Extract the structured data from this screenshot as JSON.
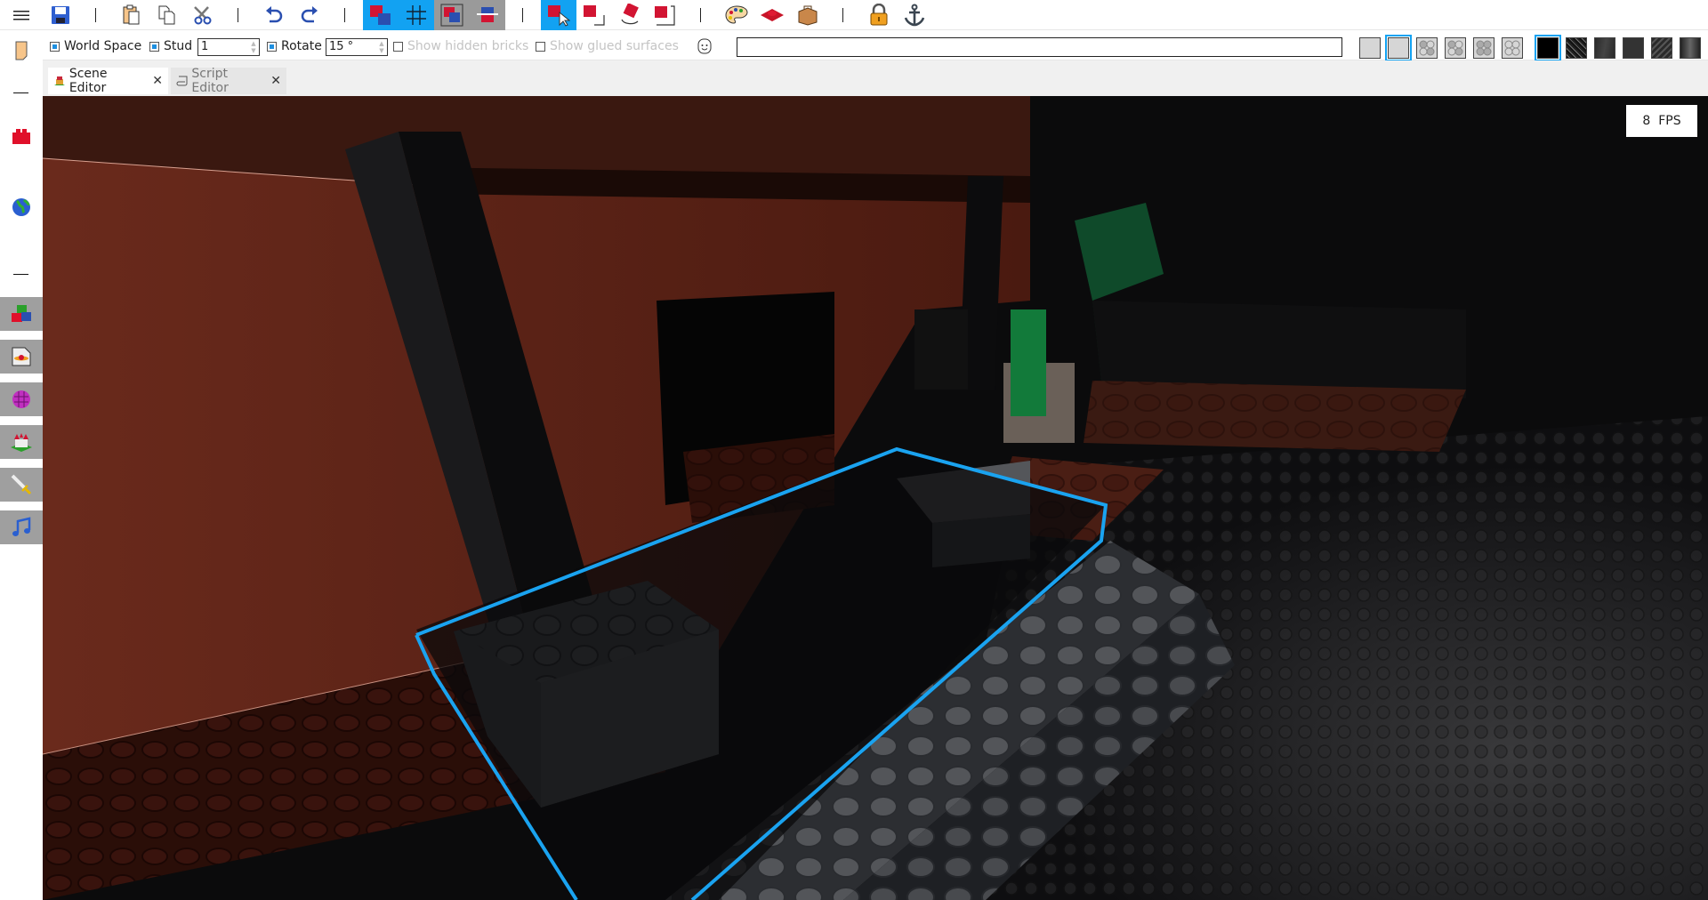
{
  "toolbar": {
    "menu": {
      "icon": "hamburger-menu-icon"
    },
    "file": [
      {
        "name": "save",
        "icon": "floppy-disk-icon"
      }
    ],
    "clipboard": [
      {
        "name": "paste",
        "icon": "paste-icon"
      },
      {
        "name": "copy",
        "icon": "copy-icon"
      },
      {
        "name": "cut",
        "icon": "scissors-icon"
      }
    ],
    "history": [
      {
        "name": "undo",
        "icon": "undo-icon"
      },
      {
        "name": "redo",
        "icon": "redo-icon"
      }
    ],
    "snap": [
      {
        "name": "brick-snap",
        "icon": "brick-snap-icon",
        "state": "active"
      },
      {
        "name": "grid-snap",
        "icon": "grid-icon",
        "state": "active"
      },
      {
        "name": "overlap-check",
        "icon": "brick-overlap-icon",
        "state": "pressed"
      },
      {
        "name": "align",
        "icon": "align-brick-icon",
        "state": "pressed"
      }
    ],
    "transform": [
      {
        "name": "select",
        "icon": "select-brick-icon",
        "state": "active"
      },
      {
        "name": "move",
        "icon": "move-brick-icon",
        "state": "normal"
      },
      {
        "name": "rotate",
        "icon": "rotate-brick-icon",
        "state": "normal"
      },
      {
        "name": "scale",
        "icon": "scale-brick-icon",
        "state": "normal"
      }
    ],
    "tools": [
      {
        "name": "paint",
        "icon": "palette-icon"
      },
      {
        "name": "surface",
        "icon": "stud-surface-icon"
      },
      {
        "name": "material",
        "icon": "wood-material-icon"
      }
    ],
    "properties": [
      {
        "name": "lock",
        "icon": "lock-icon"
      },
      {
        "name": "anchor",
        "icon": "anchor-icon"
      }
    ]
  },
  "options": {
    "world_space": {
      "label": "World Space",
      "checked": true
    },
    "stud": {
      "label": "Stud",
      "checked": true,
      "value": "1"
    },
    "rotate": {
      "label": "Rotate",
      "checked": true,
      "value": "15 °"
    },
    "show_hidden_bricks": {
      "label": "Show hidden bricks",
      "checked": false
    },
    "show_glued_surfaces": {
      "label": "Show glued surfaces",
      "checked": false
    },
    "emoji_icon": "smiley-icon",
    "search": {
      "value": "",
      "placeholder": ""
    },
    "stud_styles": [
      {
        "name": "smooth",
        "selected": false
      },
      {
        "name": "smooth-outline",
        "selected": true
      },
      {
        "name": "studs-diagonal-a",
        "selected": false
      },
      {
        "name": "studs-diagonal-b",
        "selected": false
      },
      {
        "name": "studs-full",
        "selected": false
      },
      {
        "name": "studs-empty",
        "selected": false
      }
    ],
    "textures": [
      {
        "name": "black",
        "selected": true
      },
      {
        "name": "noise",
        "selected": false
      },
      {
        "name": "scratched",
        "selected": false
      },
      {
        "name": "dark-plain",
        "selected": false
      },
      {
        "name": "rough",
        "selected": false
      },
      {
        "name": "metallic",
        "selected": false
      }
    ]
  },
  "sidebar": {
    "top": [
      {
        "name": "bookmark",
        "icon": "bookmark-icon"
      },
      {
        "name": "brick",
        "icon": "red-brick-icon"
      },
      {
        "name": "world",
        "icon": "globe-icon"
      }
    ],
    "panels": [
      {
        "name": "bricks",
        "icon": "bricks-icon"
      },
      {
        "name": "decals",
        "icon": "decal-image-icon"
      },
      {
        "name": "environment",
        "icon": "grid-globe-icon"
      },
      {
        "name": "game",
        "icon": "castle-icon"
      },
      {
        "name": "weapons",
        "icon": "sword-icon"
      },
      {
        "name": "audio",
        "icon": "music-note-icon"
      }
    ]
  },
  "tabs": [
    {
      "label": "Scene Editor",
      "icon": "scene-icon",
      "active": true,
      "close": "✕"
    },
    {
      "label": "Script Editor",
      "icon": "script-scroll-icon",
      "active": false,
      "close": "✕"
    }
  ],
  "viewport": {
    "fps_label": "8  FPS",
    "selection_color": "#1aa3f0"
  },
  "colors": {
    "accent": "#12a2f2",
    "pressed": "#9a9a9a",
    "panel_bg": "#9f9f9f"
  }
}
